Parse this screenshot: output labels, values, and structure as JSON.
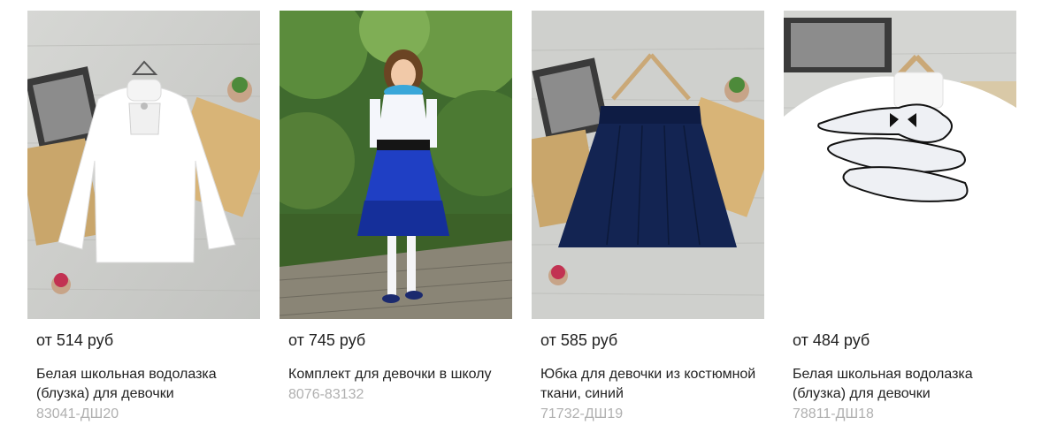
{
  "products": [
    {
      "price": "от 514 руб",
      "title": "Белая школьная водолазка (блузка) для девочки",
      "sku": "83041-ДШ20",
      "image_alt": "white-blouse-photo"
    },
    {
      "price": "от 745 руб",
      "title": "Комплект для девочки в школу",
      "sku": "8076-83132",
      "image_alt": "girl-school-outfit-photo"
    },
    {
      "price": "от 585 руб",
      "title": "Юбка для девочки из костюмной ткани, синий",
      "sku": "71732-ДШ19",
      "image_alt": "navy-skirt-photo"
    },
    {
      "price": "от 484 руб",
      "title": "Белая школьная водолазка (блузка) для девочки",
      "sku": "78811-ДШ18",
      "image_alt": "white-ruffle-blouse-photo"
    }
  ],
  "colors": {
    "text": "#222222",
    "sku": "#b0b0b0",
    "background": "#ffffff"
  }
}
